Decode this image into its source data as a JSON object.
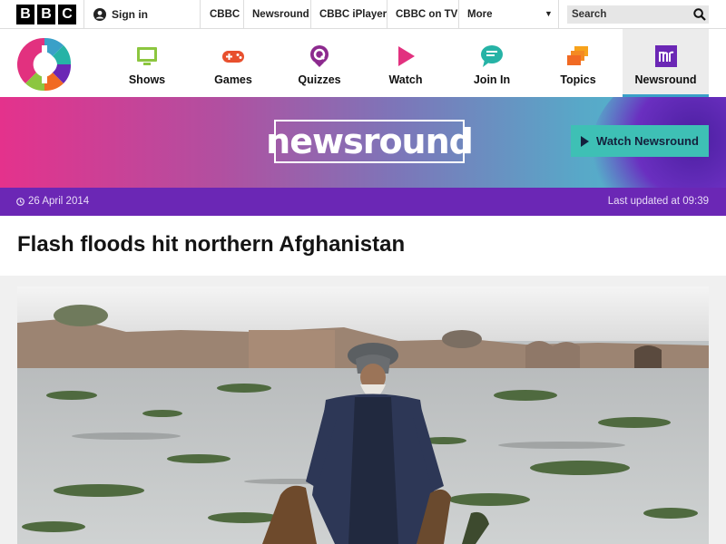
{
  "bbc_bar": {
    "logo_letters": [
      "B",
      "B",
      "C"
    ],
    "sign_in": "Sign in",
    "links": [
      "CBBC",
      "Newsround",
      "CBBC iPlayer",
      "CBBC on TV",
      "More"
    ],
    "search_placeholder": "Search"
  },
  "cbbc_nav": {
    "items": [
      {
        "label": "Shows",
        "icon": "tv-icon",
        "color": "#8cc63f"
      },
      {
        "label": "Games",
        "icon": "gamepad-icon",
        "color": "#e8502e"
      },
      {
        "label": "Quizzes",
        "icon": "quiz-icon",
        "color": "#8c2a8e"
      },
      {
        "label": "Watch",
        "icon": "play-icon",
        "color": "#e2317f"
      },
      {
        "label": "Join In",
        "icon": "chat-icon",
        "color": "#26b3a6"
      },
      {
        "label": "Topics",
        "icon": "cards-icon",
        "color": "#f16a23"
      },
      {
        "label": "Newsround",
        "icon": "newsround-icon",
        "color": "#6b27b5",
        "active": true
      }
    ]
  },
  "banner": {
    "logo_text": "newsround",
    "watch_button": "Watch Newsround"
  },
  "article": {
    "date": "26 April 2014",
    "last_updated": "Last updated at 09:39",
    "title": "Flash floods hit northern Afghanistan"
  },
  "colors": {
    "date_bar": "#6b27b5",
    "watch_button": "#3ec0b5"
  }
}
